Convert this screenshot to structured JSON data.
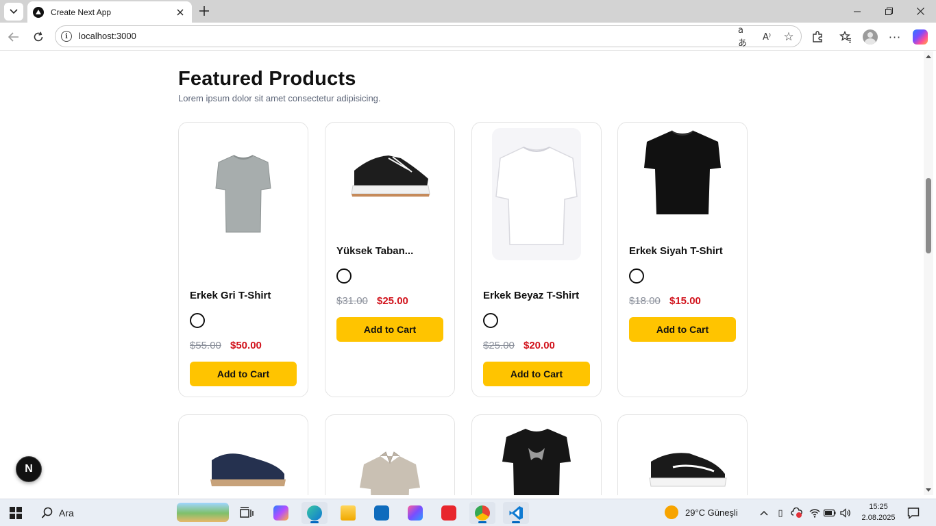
{
  "browser": {
    "tab_title": "Create Next App",
    "address": "localhost:3000"
  },
  "page": {
    "heading": "Featured Products",
    "subheading": "Lorem ipsum dolor sit amet consectetur adipisicing.",
    "next_badge": "N"
  },
  "products": [
    {
      "name": "Erkek Gri T-Shirt",
      "old_price": "$55.00",
      "price": "$50.00",
      "button": "Add to Cart",
      "image": "grey-tshirt"
    },
    {
      "name": "Yüksek Taban...",
      "old_price": "$31.00",
      "price": "$25.00",
      "button": "Add to Cart",
      "image": "black-platform-sneaker"
    },
    {
      "name": "Erkek Beyaz T-Shirt",
      "old_price": "$25.00",
      "price": "$20.00",
      "button": "Add to Cart",
      "image": "white-tshirt"
    },
    {
      "name": "Erkek Siyah T-Shirt",
      "old_price": "$18.00",
      "price": "$15.00",
      "button": "Add to Cart",
      "image": "black-tshirt"
    }
  ],
  "products_row2": [
    {
      "image": "navy-suede-shoe"
    },
    {
      "image": "beige-polo"
    },
    {
      "image": "black-graphic-tshirt"
    },
    {
      "image": "black-skate-sneaker"
    }
  ],
  "taskbar": {
    "search_label": "Ara",
    "weather": "29°C  Güneşli",
    "time": "15:25",
    "date": "2.08.2025"
  },
  "colors": {
    "accent_button": "#ffc400",
    "sale_price": "#d1121b",
    "old_price": "#8a8f9a"
  }
}
